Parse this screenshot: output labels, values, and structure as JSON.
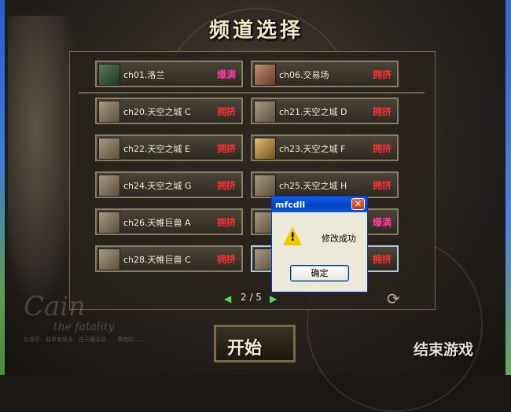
{
  "window": {
    "title": "频道选择"
  },
  "channels": [
    {
      "name": "ch01.洛兰",
      "status": "爆满",
      "status_color": "#ff3aa0"
    },
    {
      "name": "ch06.交易场",
      "status": "拥挤",
      "status_color": "#ff3030"
    },
    {
      "name": "ch20.天空之城 C",
      "status": "拥挤",
      "status_color": "#ff3030"
    },
    {
      "name": "ch21.天空之城 D",
      "status": "拥挤",
      "status_color": "#ff3030"
    },
    {
      "name": "ch22.天空之城 E",
      "status": "拥挤",
      "status_color": "#ff3030"
    },
    {
      "name": "ch23.天空之城 F",
      "status": "拥挤",
      "status_color": "#ff3030"
    },
    {
      "name": "ch24.天空之城 G",
      "status": "拥挤",
      "status_color": "#ff3030"
    },
    {
      "name": "ch25.天空之城 H",
      "status": "拥挤",
      "status_color": "#ff3030"
    },
    {
      "name": "ch26.天帷巨兽 A",
      "status": "拥挤",
      "status_color": "#ff3030"
    },
    {
      "name": "",
      "status": "爆满",
      "status_color": "#ff3aa0"
    },
    {
      "name": "ch28.天帷巨兽 C",
      "status": "拥挤",
      "status_color": "#ff3030"
    },
    {
      "name": "",
      "status": "拥挤",
      "status_color": "#ff3030"
    }
  ],
  "pagination": {
    "prev": "◀",
    "page": "2 / 5",
    "next": "▶"
  },
  "refresh_icon": "refresh-icon",
  "buttons": {
    "start": "开始",
    "quit": "结束游戏"
  },
  "logo": {
    "line1": "Cain",
    "line2": "the fatality"
  },
  "lore": "在很早，曲界有很多，由于魔法及……黑暗的……",
  "dialog": {
    "title": "mfcdll",
    "close": "✕",
    "message": "修改成功",
    "ok": "确定",
    "icon": "warning-icon"
  }
}
